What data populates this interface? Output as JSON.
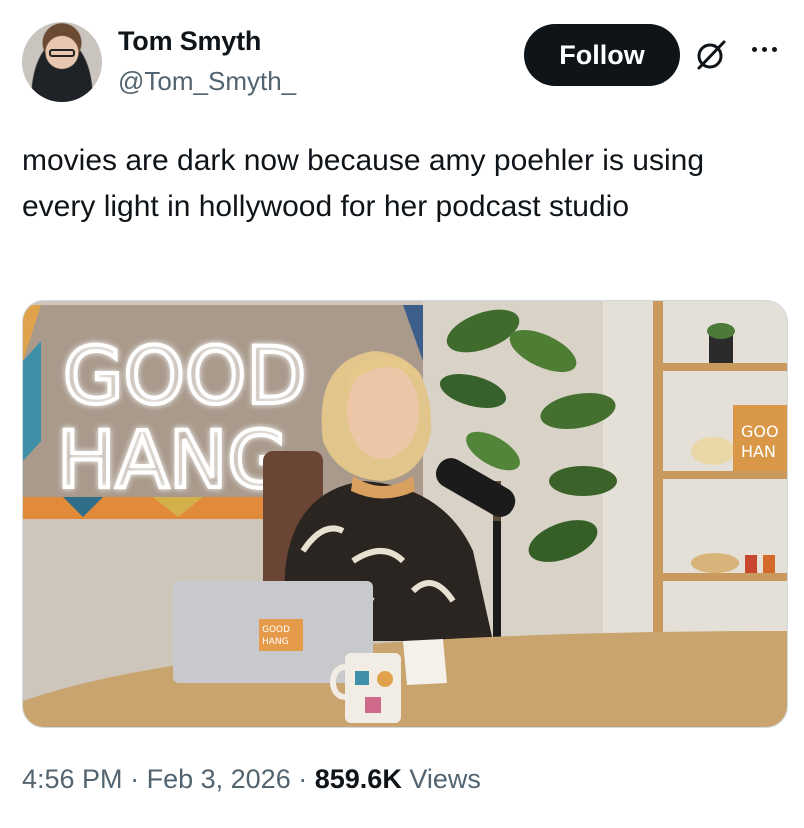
{
  "author": {
    "name": "Tom Smyth",
    "handle": "@Tom_Smyth_"
  },
  "actions": {
    "follow_label": "Follow"
  },
  "tweet": {
    "text": "movies are dark now because amy poehler is using every light in hollywood for her podcast studio"
  },
  "media": {
    "neon_sign_line1": "GOOD",
    "neon_sign_line2": "HANG",
    "shelf_sign_line1": "GOO",
    "shelf_sign_line2": "HAN",
    "laptop_sticker_line1": "GOOD",
    "laptop_sticker_line2": "HANG"
  },
  "meta": {
    "time": "4:56 PM",
    "separator": "·",
    "date": "Feb 3, 2026",
    "views_count": "859.6K",
    "views_label": "Views"
  },
  "colors": {
    "follow_bg": "#0f1419",
    "secondary_text": "#536471",
    "border": "#cfd9de"
  },
  "icons": [
    "grok-icon",
    "more-icon"
  ]
}
